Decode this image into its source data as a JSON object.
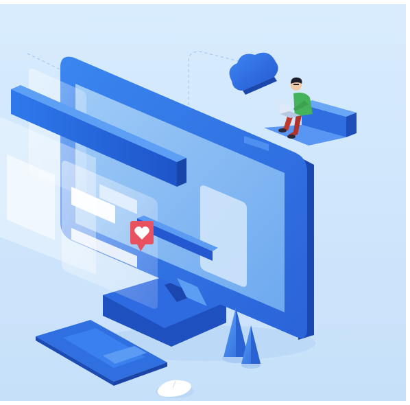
{
  "scene": {
    "description_free": true,
    "palette": {
      "background": "#cfe6fb",
      "monitor_front": "#2f6fe0",
      "monitor_side": "#1e4fb8",
      "screen": "#8fc0f5",
      "panel_light": "#eef6ff",
      "accent_red": "#e74c5a",
      "person_shirt": "#45b35c",
      "person_pants": "#c0392b"
    },
    "icons": [
      "monitor-illustration",
      "cloud-icon",
      "person-with-laptop",
      "heart-notification-icon",
      "keyboard",
      "mouse",
      "tree-decoration"
    ]
  }
}
